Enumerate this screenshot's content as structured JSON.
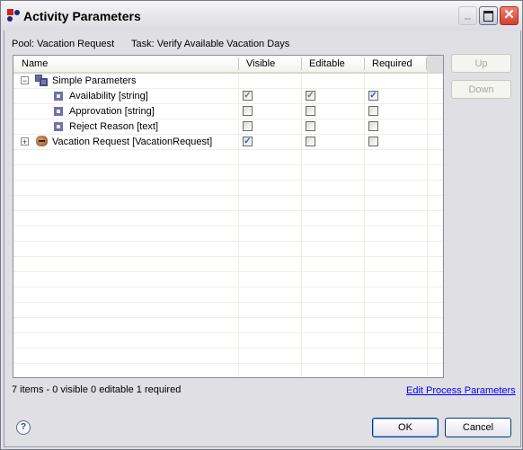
{
  "window": {
    "title": "Activity Parameters",
    "close_glyph": "✕"
  },
  "info": {
    "pool": "Pool: Vacation Request",
    "task": "Task: Verify Available Vacation Days"
  },
  "table": {
    "columns": [
      "Name",
      "Visible",
      "Editable",
      "Required"
    ],
    "rows": [
      {
        "label": "Simple Parameters",
        "icon": "parameter-group-icon",
        "toggle": "⊟",
        "level": 0,
        "visible": null,
        "editable": null,
        "required": null
      },
      {
        "label": "Availability [string]",
        "icon": "parameter-icon",
        "level": 1,
        "visible": "checked-disabled",
        "editable": "checked-disabled",
        "required": "checked"
      },
      {
        "label": "Approvation [string]",
        "icon": "parameter-icon",
        "level": 1,
        "visible": "unchecked",
        "editable": "unchecked",
        "required": "unchecked"
      },
      {
        "label": "Reject Reason [text]",
        "icon": "parameter-icon",
        "level": 1,
        "visible": "unchecked",
        "editable": "unchecked",
        "required": "unchecked"
      },
      {
        "label": "Vacation Request [VacationRequest]",
        "icon": "business-object-icon",
        "toggle": "+",
        "level": 0,
        "visible": "checked",
        "editable": "unchecked",
        "required": "unchecked"
      }
    ],
    "check_glyph": "✓",
    "minus_glyph": "−",
    "plus_glyph": "+"
  },
  "side_buttons": {
    "up": "Up",
    "down": "Down"
  },
  "status": "7 items - 0 visible  0 editable  1 required",
  "link": "Edit Process Parameters",
  "help_glyph": "?",
  "buttons": {
    "ok": "OK",
    "cancel": "Cancel"
  }
}
